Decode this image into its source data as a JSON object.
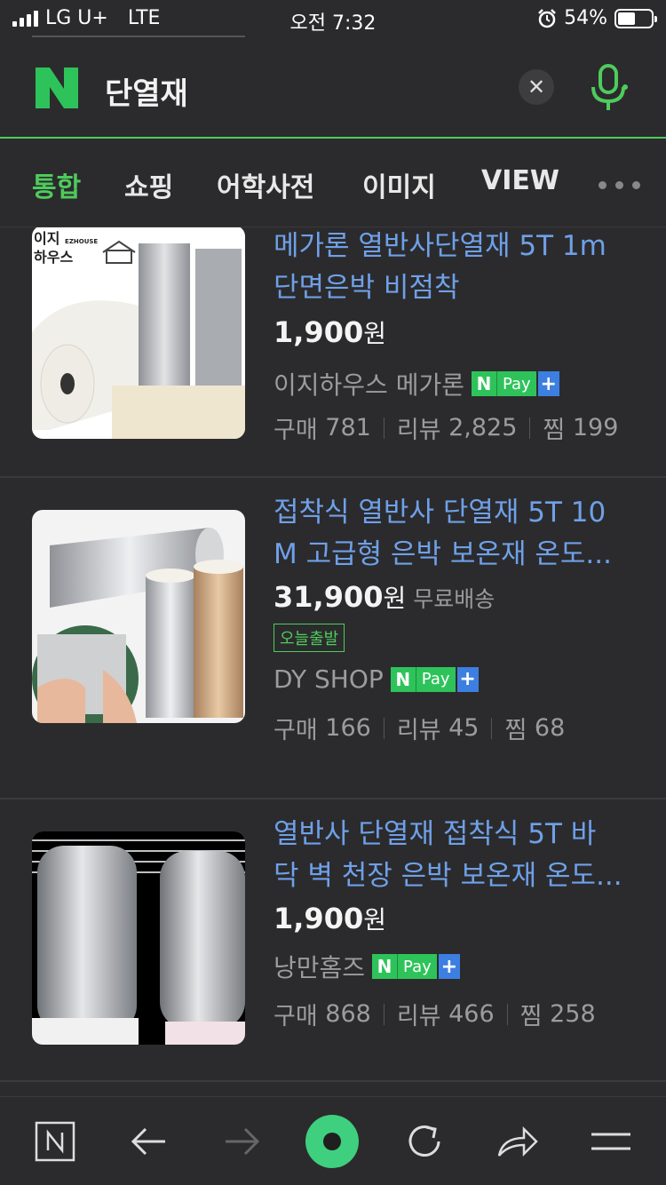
{
  "status_bar": {
    "carrier": "LG U+",
    "network": "LTE",
    "time": "오전 7:32",
    "battery_percent": "54%",
    "battery_level": 0.54
  },
  "search": {
    "query": "단열재",
    "clear_icon": "close-icon",
    "voice_icon": "microphone-icon",
    "accent": "#4ecb5c"
  },
  "tabs": [
    {
      "label": "통합",
      "active": true
    },
    {
      "label": "쇼핑"
    },
    {
      "label": "어학사전"
    },
    {
      "label": "이미지"
    },
    {
      "label": "VIEW"
    }
  ],
  "products": [
    {
      "title_line1": "메가론 열반사단열재 5T 1m",
      "title_line2": "단면은박 비점착",
      "price": "1,900",
      "currency": "원",
      "shipping": "",
      "badge": "",
      "seller": "이지하우스 메가론",
      "npay": {
        "n": "N",
        "pay": "Pay",
        "plus": "+"
      },
      "purchases_label": "구매",
      "purchases": "781",
      "reviews_label": "리뷰",
      "reviews": "2,825",
      "likes_label": "찜",
      "likes": "199",
      "thumb_label_top": "이지",
      "thumb_label_bottom": "하우스",
      "thumb_brand": "EZHOUSE"
    },
    {
      "title_line1": "접착식 열반사 단열재 5T 10",
      "title_line2": "M 고급형 은박 보온재 온도...",
      "price": "31,900",
      "currency": "원",
      "shipping": "무료배송",
      "badge": "오늘출발",
      "seller": "DY SHOP",
      "npay": {
        "n": "N",
        "pay": "Pay",
        "plus": "+"
      },
      "purchases_label": "구매",
      "purchases": "166",
      "reviews_label": "리뷰",
      "reviews": "45",
      "likes_label": "찜",
      "likes": "68"
    },
    {
      "title_line1": "열반사 단열재 접착식 5T 바",
      "title_line2": "닥 벽 천장 은박 보온재 온도...",
      "price": "1,900",
      "currency": "원",
      "shipping": "",
      "badge": "",
      "seller": "낭만홈즈",
      "npay": {
        "n": "N",
        "pay": "Pay",
        "plus": "+"
      },
      "purchases_label": "구매",
      "purchases": "868",
      "reviews_label": "리뷰",
      "reviews": "466",
      "likes_label": "찜",
      "likes": "258"
    }
  ],
  "bottom_bar": {
    "icons": [
      "naver-home-icon",
      "back-arrow-icon",
      "forward-arrow-icon",
      "green-dot-icon",
      "refresh-icon",
      "share-icon",
      "menu-icon"
    ]
  }
}
